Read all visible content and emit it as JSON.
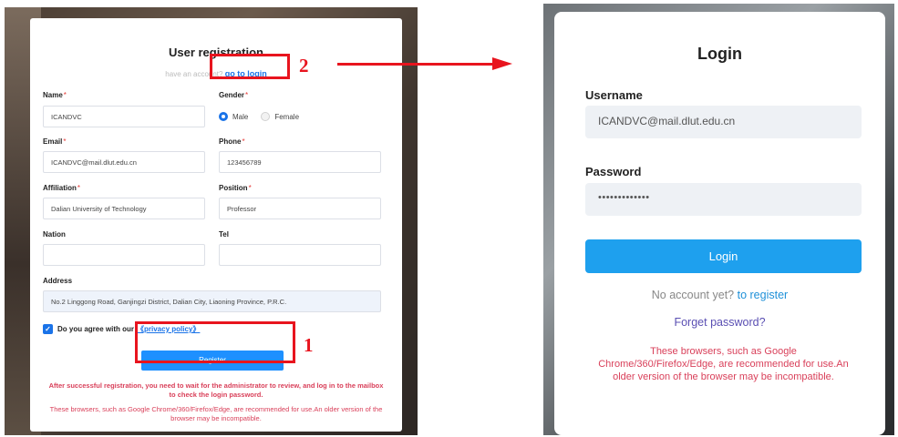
{
  "registration": {
    "title": "User registration",
    "have_account": "have an account?",
    "go_to_login": "go to login",
    "fields": {
      "name": {
        "label": "Name",
        "value": "ICANDVC"
      },
      "gender": {
        "label": "Gender",
        "options": [
          "Male",
          "Female"
        ],
        "selected": "Male"
      },
      "email": {
        "label": "Email",
        "value": "ICANDVC@mail.dlut.edu.cn"
      },
      "phone": {
        "label": "Phone",
        "value": "123456789"
      },
      "affiliation": {
        "label": "Affiliation",
        "value": "Dalian University of Technology"
      },
      "position": {
        "label": "Position",
        "value": "Professor"
      },
      "nation": {
        "label": "Nation",
        "value": ""
      },
      "tel": {
        "label": "Tel",
        "value": ""
      },
      "address": {
        "label": "Address",
        "value": "No.2 Linggong Road, Ganjingzi District, Dalian City, Liaoning Province, P.R.C."
      }
    },
    "required_mark": "*",
    "agree_text": "Do you agree with our",
    "privacy_link": "《privacy policy》",
    "register_button": "Register",
    "review_note": "After successful registration, you need to wait for the administrator to review, and log in to the mailbox to check the login password.",
    "browser_note": "These browsers, such as Google Chrome/360/Firefox/Edge, are recommended for use.An older version of the browser may be incompatible."
  },
  "annotations": {
    "step1": "1",
    "step2": "2"
  },
  "login": {
    "title": "Login",
    "username_label": "Username",
    "username_value": "ICANDVC@mail.dlut.edu.cn",
    "password_label": "Password",
    "password_value": "•••••••••••••",
    "login_button": "Login",
    "no_account": "No account yet?",
    "to_register": "to register",
    "forget_password": "Forget password?",
    "browser_note": "These browsers, such as Google Chrome/360/Firefox/Edge, are recommended for use.An older version of the browser may be incompatible."
  },
  "colors": {
    "accent_blue": "#1e90ff",
    "warning_red": "#d9405a",
    "annotation_red": "#e8141e"
  }
}
